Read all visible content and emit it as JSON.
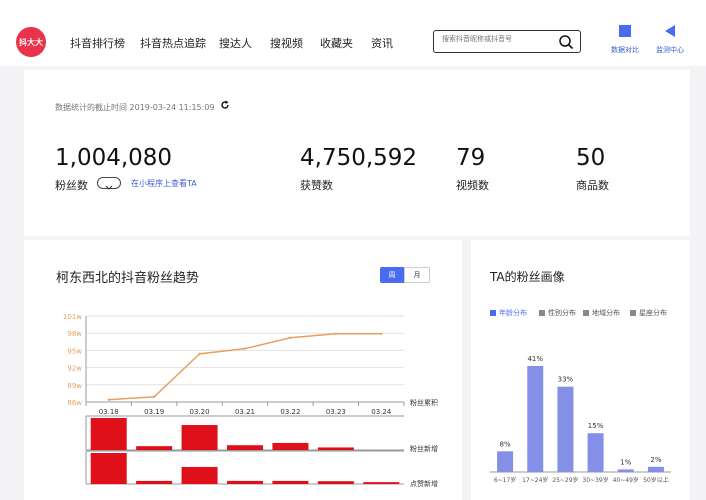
{
  "logo": {
    "text": "抖大大"
  },
  "nav": [
    {
      "label": "抖音排行榜"
    },
    {
      "label": "抖音热点追踪"
    },
    {
      "label": "搜达人"
    },
    {
      "label": "搜视频"
    },
    {
      "label": "收藏夹"
    },
    {
      "label": "资讯"
    }
  ],
  "search": {
    "placeholder": "搜索抖音昵称或抖音号"
  },
  "top_icons": [
    {
      "label": "数据对比",
      "icon": "compare-icon"
    },
    {
      "label": "监测中心",
      "icon": "monitor-icon"
    }
  ],
  "stats": {
    "timestamp": "数据统计的截止时间 2019-03-24 11:15:09",
    "items": [
      {
        "value": "1,004,080",
        "label": "粉丝数"
      },
      {
        "value": "4,750,592",
        "label": "获赞数"
      },
      {
        "value": "79",
        "label": "视频数"
      },
      {
        "value": "50",
        "label": "商品数"
      }
    ],
    "mini_link": "在小程序上查看TA"
  },
  "trend": {
    "title": "柯东西北的抖音粉丝趋势",
    "tabs": {
      "week": "周",
      "month": "月"
    },
    "row_labels": {
      "cumulative": "粉丝累积",
      "new": "粉丝新增",
      "likes": "点赞新增"
    }
  },
  "fans": {
    "title": "TA的粉丝画像",
    "legend": [
      {
        "label": "年龄分布",
        "color": "#4a6cf0"
      },
      {
        "label": "性别分布",
        "color": "#888888"
      },
      {
        "label": "地域分布",
        "color": "#888888"
      },
      {
        "label": "星座分布",
        "color": "#888888"
      }
    ]
  },
  "chart_data": [
    {
      "type": "line",
      "title": "柯东西北的抖音粉丝趋势",
      "x": [
        "03.18",
        "03.19",
        "03.20",
        "03.21",
        "03.22",
        "03.23",
        "03.24"
      ],
      "series": [
        {
          "name": "粉丝累积",
          "values": [
            86.4,
            86.9,
            94.4,
            95.3,
            97.2,
            97.9,
            97.9
          ]
        }
      ],
      "yticks": [
        "86w",
        "89w",
        "92w",
        "95w",
        "98w",
        "101w"
      ],
      "ylim": [
        86,
        101
      ],
      "color": "#e8a060",
      "grid": true
    },
    {
      "type": "bar",
      "categories": [
        "03.18",
        "03.19",
        "03.20",
        "03.21",
        "03.22",
        "03.23",
        "03.24"
      ],
      "series": [
        {
          "name": "粉丝新增",
          "values": [
            10,
            1.2,
            7.8,
            1.5,
            2.2,
            0.8,
            0
          ]
        }
      ],
      "color": "#e0101a"
    },
    {
      "type": "bar",
      "categories": [
        "03.18",
        "03.19",
        "03.20",
        "03.21",
        "03.22",
        "03.23",
        "03.24"
      ],
      "series": [
        {
          "name": "点赞新增",
          "values": [
            10,
            1.0,
            5.5,
            1.0,
            1.0,
            0.9,
            0.6
          ]
        }
      ],
      "color": "#e0101a"
    },
    {
      "type": "bar",
      "title": "TA的粉丝画像",
      "categories": [
        "6~17岁",
        "17~24岁",
        "25~29岁",
        "30~39岁",
        "40~49岁",
        "50岁以上"
      ],
      "values": [
        8,
        41,
        33,
        15,
        1,
        2
      ],
      "value_labels": [
        "8%",
        "41%",
        "33%",
        "15%",
        "1%",
        "2%"
      ],
      "color": "#8490e8"
    }
  ]
}
